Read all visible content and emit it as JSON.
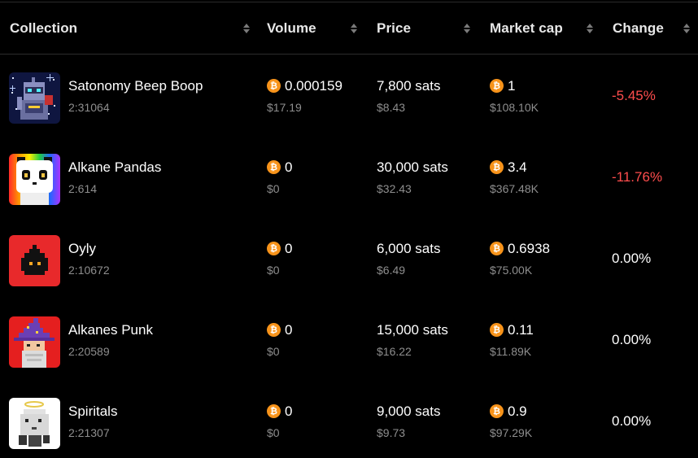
{
  "columns": [
    {
      "label": "Collection"
    },
    {
      "label": "Volume"
    },
    {
      "label": "Price"
    },
    {
      "label": "Market cap"
    },
    {
      "label": "Change"
    }
  ],
  "colors": {
    "change_negative": "#ff4d4d",
    "change_neutral": "#ffffff",
    "btc": "#f7931a"
  },
  "btc_symbol": "₿",
  "rows": [
    {
      "name": "Satonomy Beep Boop",
      "id": "2:31064",
      "volume": "0.000159",
      "volume_usd": "$17.19",
      "price": "7,800 sats",
      "price_usd": "$8.43",
      "market_cap": "1",
      "market_cap_usd": "$108.10K",
      "change": "-5.45%",
      "icon": "robot-avatar-icon"
    },
    {
      "name": "Alkane Pandas",
      "id": "2:614",
      "volume": "0",
      "volume_usd": "$0",
      "price": "30,000 sats",
      "price_usd": "$32.43",
      "market_cap": "3.4",
      "market_cap_usd": "$367.48K",
      "change": "-11.76%",
      "icon": "panda-avatar-icon"
    },
    {
      "name": "Oyly",
      "id": "2:10672",
      "volume": "0",
      "volume_usd": "$0",
      "price": "6,000 sats",
      "price_usd": "$6.49",
      "market_cap": "0.6938",
      "market_cap_usd": "$75.00K",
      "change": "0.00%",
      "icon": "oil-drop-avatar-icon"
    },
    {
      "name": "Alkanes Punk",
      "id": "2:20589",
      "volume": "0",
      "volume_usd": "$0",
      "price": "15,000 sats",
      "price_usd": "$16.22",
      "market_cap": "0.11",
      "market_cap_usd": "$11.89K",
      "change": "0.00%",
      "icon": "wizard-avatar-icon"
    },
    {
      "name": "Spiritals",
      "id": "2:21307",
      "volume": "0",
      "volume_usd": "$0",
      "price": "9,000 sats",
      "price_usd": "$9.73",
      "market_cap": "0.9",
      "market_cap_usd": "$97.29K",
      "change": "0.00%",
      "icon": "ghost-avatar-icon"
    }
  ]
}
